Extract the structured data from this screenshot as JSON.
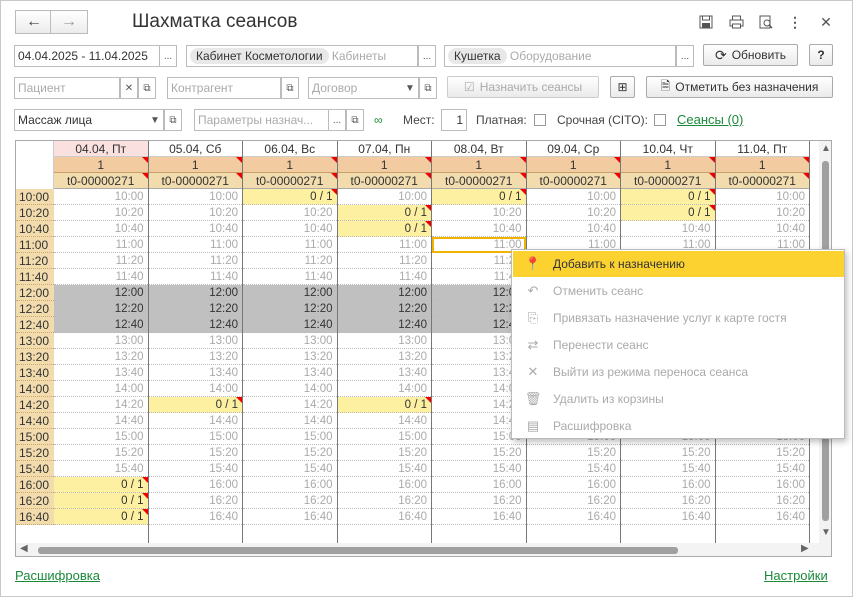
{
  "header": {
    "title": "Шахматка сеансов"
  },
  "filters": {
    "period": "04.04.2025 - 11.04.2025",
    "cabinet_tag": "Кабинет Косметологии",
    "cabinet_ph": "Кабинеты",
    "equip_tag": "Кушетка",
    "equip_ph": "Оборудование",
    "refresh": "Обновить",
    "help": "?",
    "patient_ph": "Пациент",
    "contractor_ph": "Контрагент",
    "contract_ph": "Договор",
    "assign": "Назначить сеансы",
    "mark": "Отметить без назначения",
    "service": "Массаж лица",
    "params_ph": "Параметры назнач...",
    "places_label": "Мест:",
    "places": "1",
    "paid_label": "Платная:",
    "urgent_label": "Срочная (CITO):",
    "sessions_link": "Сеансы (0)"
  },
  "grid": {
    "days": [
      "04.04, Пт",
      "05.04, Сб",
      "06.04, Вс",
      "07.04, Пн",
      "08.04, Вт",
      "09.04, Ср",
      "10.04, Чт",
      "11.04, Пт"
    ],
    "count": "1",
    "code": "t0-00000271",
    "times": [
      "10:00",
      "10:20",
      "10:40",
      "11:00",
      "11:20",
      "11:40",
      "12:00",
      "12:20",
      "12:40",
      "13:00",
      "13:20",
      "13:40",
      "14:00",
      "14:20",
      "14:40",
      "15:00",
      "15:20",
      "15:40",
      "16:00",
      "16:20",
      "16:40"
    ],
    "booked": "0 / 1",
    "booked_cells": [
      [
        0,
        2
      ],
      [
        0,
        6
      ],
      [
        1,
        3
      ],
      [
        1,
        6
      ],
      [
        2,
        3
      ],
      [
        0,
        4
      ],
      [
        13,
        1
      ],
      [
        13,
        3
      ],
      [
        18,
        0
      ],
      [
        19,
        0
      ],
      [
        20,
        0
      ]
    ],
    "lunch_rows": [
      6,
      7,
      8
    ]
  },
  "context_menu": {
    "items": [
      {
        "label": "Добавить к назначению",
        "icon": "map-pin-icon"
      },
      {
        "label": "Отменить сеанс",
        "icon": "undo-icon"
      },
      {
        "label": "Привязать назначение услуг к карте гостя",
        "icon": "attach-icon"
      },
      {
        "label": "Перенести сеанс",
        "icon": "swap-icon"
      },
      {
        "label": "Выйти из режима переноса сеанса",
        "icon": "close-icon"
      },
      {
        "label": "Удалить из корзины",
        "icon": "trash-icon"
      },
      {
        "label": "Расшифровка",
        "icon": "document-icon"
      }
    ]
  },
  "footer": {
    "left_link": "Расшифровка",
    "right_link": "Настройки"
  }
}
